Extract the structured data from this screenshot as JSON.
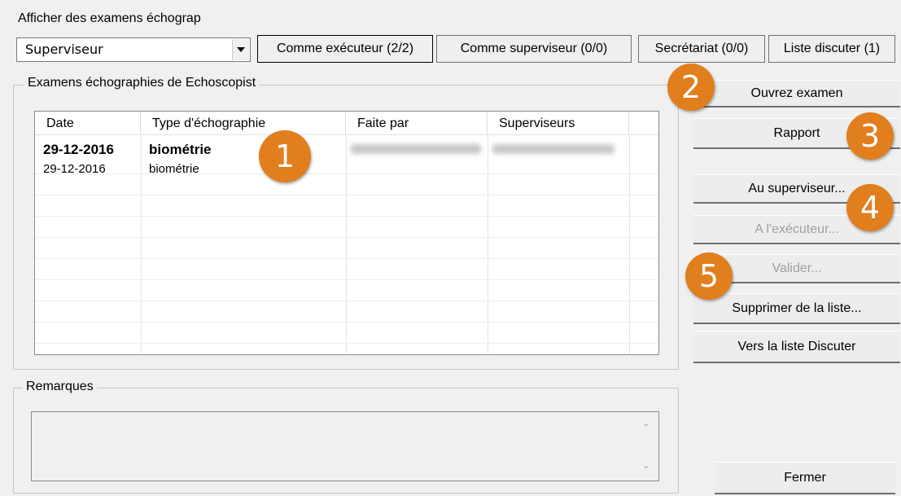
{
  "filter_label": "Afficher des examens échograp",
  "role_select": {
    "value": "Superviseur"
  },
  "tabs": {
    "executor": "Comme exécuteur (2/2)",
    "supervisor": "Comme superviseur (0/0)",
    "secretariat": "Secrétariat (0/0)",
    "discuss": "Liste discuter (1)"
  },
  "exams_group": {
    "title": "Examens échographies de Echoscopist",
    "columns": [
      "Date",
      "Type d'échographie",
      "Faite par",
      "Superviseurs"
    ],
    "rows": [
      {
        "date": "29-12-2016",
        "type": "biométrie",
        "bold": true
      },
      {
        "date": "29-12-2016",
        "type": "biométrie",
        "bold": false
      }
    ]
  },
  "actions": {
    "open": "Ouvrez examen",
    "report": "Rapport",
    "to_supervisor": "Au superviseur...",
    "to_executor": "A l'exécuteur...",
    "validate": "Valider...",
    "remove": "Supprimer de la liste...",
    "to_discuss": "Vers la liste Discuter",
    "close": "Fermer"
  },
  "remarks": {
    "title": "Remarques"
  },
  "badges": [
    "1",
    "2",
    "3",
    "4",
    "5"
  ],
  "colors": {
    "badge": "#e17e1e"
  }
}
